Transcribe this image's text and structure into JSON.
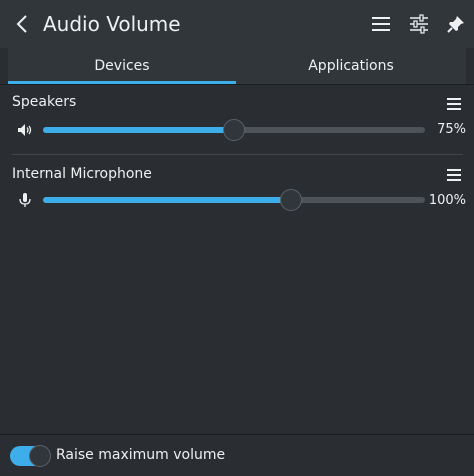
{
  "header": {
    "title": "Audio Volume",
    "icons": [
      "back-arrow-icon",
      "hamburger-menu-icon",
      "mixer-settings-icon",
      "pin-icon"
    ]
  },
  "tabs": [
    {
      "label": "Devices",
      "selected": true
    },
    {
      "label": "Applications",
      "selected": false
    }
  ],
  "devices": [
    {
      "name": "Speakers",
      "icon": "speaker-icon",
      "volume_percent": 50,
      "volume_label": "75%"
    },
    {
      "name": "Internal Microphone",
      "icon": "microphone-icon",
      "volume_percent": 65,
      "volume_label": "100%"
    }
  ],
  "footer": {
    "toggle_label": "Raise maximum volume",
    "toggle_on": true
  },
  "colors": {
    "accent": "#3daee9",
    "background": "#2a2e32",
    "header": "#31363b",
    "text": "#eff0f1"
  }
}
